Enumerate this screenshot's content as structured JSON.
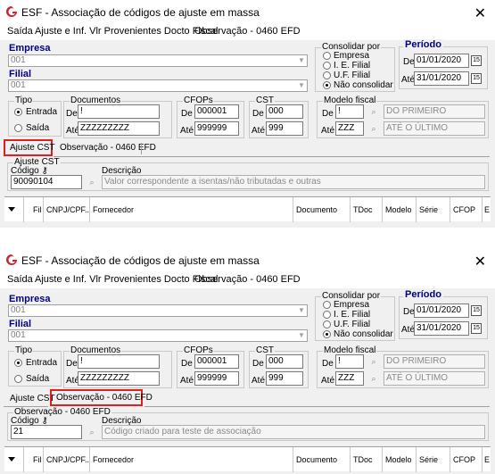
{
  "window": {
    "title": "ESF - Associação de códigos de ajuste em massa",
    "close_glyph": "✕"
  },
  "menu": [
    "Saída",
    "Ajuste e Inf. Vlr Provenientes Docto Fiscal",
    "Observação - 0460 EFD"
  ],
  "empresa": {
    "label": "Empresa",
    "value": "001"
  },
  "filial": {
    "label": "Filial",
    "value": "001"
  },
  "consolidar": {
    "caption": "Consolidar por",
    "options": [
      "Empresa",
      "I. E. Filial",
      "U.F. Filial",
      "Não consolidar"
    ],
    "selected": 3
  },
  "periodo": {
    "caption": "Período",
    "de_label": "De",
    "de_value": "01/01/2020",
    "ate_label": "Até",
    "ate_value": "31/01/2020",
    "cal_glyph": "15"
  },
  "tipo": {
    "caption": "Tipo",
    "options": [
      "Entrada",
      "Saída"
    ],
    "selected": 0
  },
  "documentos": {
    "caption": "Documentos",
    "de_label": "De",
    "de_value": "!",
    "ate_label": "Até",
    "ate_value": "ZZZZZZZZZ"
  },
  "cfops": {
    "caption": "CFOPs",
    "de_label": "De",
    "de_value": "000001",
    "ate_label": "Até",
    "ate_value": "999999"
  },
  "cst": {
    "caption": "CST",
    "de_label": "De",
    "de_value": "000",
    "ate_label": "Até",
    "ate_value": "999"
  },
  "modelo": {
    "caption": "Modelo fiscal",
    "de_label": "De",
    "de_value": "!",
    "de_desc": "DO PRIMEIRO",
    "ate_label": "Até",
    "ate_value": "ZZZ",
    "ate_desc": "ATÉ O ÚLTIMO",
    "bino_glyph": "⌕"
  },
  "tabs": [
    "Ajuste CST",
    "Observação - 0460 EFD"
  ],
  "panel1": {
    "caption": "Ajuste CST",
    "codigo_label": "Código",
    "codigo_value": "90090104",
    "descricao_label": "Descrição",
    "descricao_value": "Valor correspondente a isentas/não tributadas e outras"
  },
  "panel2": {
    "caption": "Observação - 0460 EFD",
    "codigo_label": "Código",
    "codigo_value": "21",
    "descricao_label": "Descrição",
    "descricao_value": "Código criado para teste de associação"
  },
  "grid_columns": [
    "Fil",
    "CNPJ/CPF...",
    "Fornecedor",
    "Documento",
    "TDoc",
    "Modelo",
    "Série",
    "CFOP",
    "E"
  ]
}
